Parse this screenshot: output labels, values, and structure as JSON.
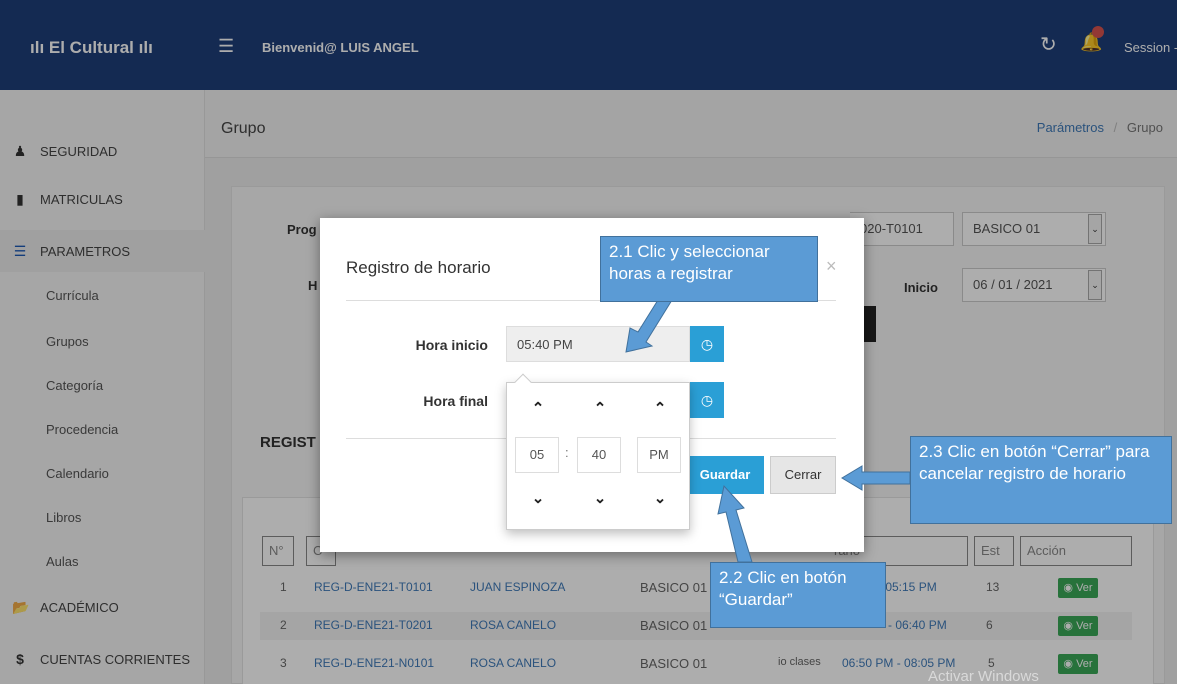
{
  "topbar": {
    "brand": "ılı El Cultural ılı",
    "welcome": "Bienvenid@ LUIS ANGEL",
    "session": "Session -"
  },
  "sidebar": {
    "items": [
      {
        "label": "SEGURIDAD",
        "icon": "user-icon"
      },
      {
        "label": "MATRICULAS",
        "icon": "book-icon"
      },
      {
        "label": "PARAMETROS",
        "icon": "list-icon"
      },
      {
        "label": "ACADÉMICO",
        "icon": "folder-icon"
      },
      {
        "label": "CUENTAS CORRIENTES",
        "icon": "dollar-icon"
      }
    ],
    "subitems": [
      "Currícula",
      "Grupos",
      "Categoría",
      "Procedencia",
      "Calendario",
      "Libros",
      "Aulas"
    ]
  },
  "page": {
    "title": "Grupo",
    "breadcrumb_link": "Parámetros",
    "breadcrumb_sep": "/",
    "breadcrumb_current": "Grupo"
  },
  "form": {
    "label_prog": "Prog",
    "label_h": "H",
    "code_partial": "020-T0101",
    "nivel": "BASICO 01",
    "inicio_label": "Inicio",
    "inicio_value": "06 / 01 / 2021"
  },
  "section": {
    "title_partial": "REGIST"
  },
  "table": {
    "headers": [
      "N°",
      "C",
      "rario",
      "Est",
      "Acción"
    ],
    "rows": [
      {
        "n": "1",
        "code": "REG-D-ENE21-T0101",
        "teacher": "JUAN ESPINOZA",
        "level": "BASICO 01",
        "aula": "",
        "horario": "- 05:15 PM",
        "est": "13",
        "action": "Ver"
      },
      {
        "n": "2",
        "code": "REG-D-ENE21-T0201",
        "teacher": "ROSA CANELO",
        "level": "BASICO 01",
        "aula": "",
        "horario": "- 06:40 PM",
        "est": "6",
        "action": "Ver"
      },
      {
        "n": "3",
        "code": "REG-D-ENE21-N0101",
        "teacher": "ROSA CANELO",
        "level": "BASICO 01",
        "aula": "io clases",
        "horario": "06:50 PM - 08:05 PM",
        "est": "5",
        "action": "Ver"
      }
    ]
  },
  "modal": {
    "title": "Registro de horario",
    "close": "×",
    "hora_inicio_label": "Hora inicio",
    "hora_inicio_value": "05:40 PM",
    "hora_final_label": "Hora final",
    "guardar": "Guardar",
    "cerrar": "Cerrar"
  },
  "picker": {
    "hour": "05",
    "sep": ":",
    "minute": "40",
    "meridian": "PM"
  },
  "callouts": {
    "c21": "2.1 Clic y seleccionar horas a registrar",
    "c22": "2.2 Clic en botón “Guardar”",
    "c23": "2.3 Clic en botón “Cerrar” para cancelar registro de horario"
  },
  "watermark": "Activar Windows",
  "colors": {
    "topbar": "#1e3f7a",
    "accent": "#2a9fd6",
    "callout": "#5b9bd5",
    "ver": "#3aa858"
  }
}
